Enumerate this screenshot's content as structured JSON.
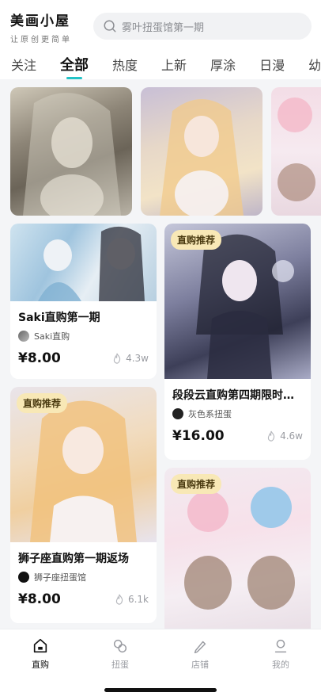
{
  "app": {
    "title": "美画小屋",
    "slogan": "让原创更简单"
  },
  "search": {
    "placeholder": "雾叶扭蛋馆第一期"
  },
  "tabs": [
    {
      "label": "关注"
    },
    {
      "label": "全部",
      "active": true
    },
    {
      "label": "热度"
    },
    {
      "label": "上新"
    },
    {
      "label": "厚涂"
    },
    {
      "label": "日漫"
    },
    {
      "label": "幼儿"
    }
  ],
  "feed": {
    "badge_label": "直购推荐",
    "cards": [
      {
        "title": "Saki直购第一期",
        "shop": "Saki直购",
        "price": "¥8.00",
        "heat": "4.3w",
        "badge": false
      },
      {
        "title": "段段云直购第四期限时…",
        "shop": "灰色系扭蛋",
        "price": "¥16.00",
        "heat": "4.6w",
        "badge": true
      },
      {
        "title": "狮子座直购第一期返场",
        "shop": "狮子座扭蛋馆",
        "price": "¥8.00",
        "heat": "6.1k",
        "badge": true
      },
      {
        "title": "",
        "shop": "",
        "price": "",
        "heat": "",
        "badge": true
      }
    ]
  },
  "nav": {
    "items": [
      {
        "label": "直购",
        "icon": "home-icon",
        "active": true
      },
      {
        "label": "扭蛋",
        "icon": "capsule-icon",
        "active": false
      },
      {
        "label": "店铺",
        "icon": "pen-icon",
        "active": false
      },
      {
        "label": "我的",
        "icon": "profile-icon",
        "active": false
      }
    ]
  },
  "colors": {
    "accent": "#23c3c6",
    "badge_bg": "#f8e8b6",
    "text_muted": "#9a9ca2"
  }
}
